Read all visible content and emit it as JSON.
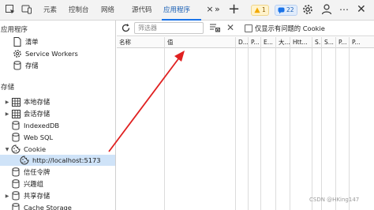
{
  "tabbar": {
    "tabs": [
      {
        "label": "元素"
      },
      {
        "label": "控制台"
      },
      {
        "label": "网络"
      },
      {
        "label": "源代码"
      },
      {
        "label": "应用程序"
      }
    ],
    "warnings_count": "1",
    "info_count": "22"
  },
  "sidebar": {
    "application_section": "应用程序",
    "application_items": [
      {
        "label": "清单",
        "icon": "document-icon"
      },
      {
        "label": "Service Workers",
        "icon": "gear-icon"
      },
      {
        "label": "存储",
        "icon": "database-icon"
      }
    ],
    "storage_section": "存储",
    "storage_items": [
      {
        "label": "本地存储",
        "icon": "grid-icon",
        "expandable": true
      },
      {
        "label": "会话存储",
        "icon": "grid-icon",
        "expandable": true
      },
      {
        "label": "IndexedDB",
        "icon": "database-icon",
        "expandable": false
      },
      {
        "label": "Web SQL",
        "icon": "database-icon",
        "expandable": false
      },
      {
        "label": "Cookie",
        "icon": "cookie-icon",
        "expandable": true,
        "expanded": true
      },
      {
        "label": "http://localhost:5173",
        "icon": "cookie-icon",
        "selected": true
      },
      {
        "label": "信任令牌",
        "icon": "database-icon",
        "expandable": false
      },
      {
        "label": "兴趣组",
        "icon": "database-icon",
        "expandable": false
      },
      {
        "label": "共享存储",
        "icon": "database-icon",
        "expandable": true
      },
      {
        "label": "Cache Storage",
        "icon": "database-icon",
        "expandable": false
      }
    ]
  },
  "toolbar": {
    "filter_placeholder": "筛选器",
    "only_issues_label": "仅显示有问题的 Cookie"
  },
  "table": {
    "columns": [
      "名称",
      "值",
      "D...",
      "P...",
      "E...",
      "大...",
      "Htt...",
      "S...",
      "S...",
      "P...",
      "P..."
    ]
  },
  "watermark": "CSDN @HKing147",
  "colors": {
    "accent": "#1a73e8",
    "selected_row": "#cfe3f8",
    "annotation_arrow": "#e02020"
  }
}
